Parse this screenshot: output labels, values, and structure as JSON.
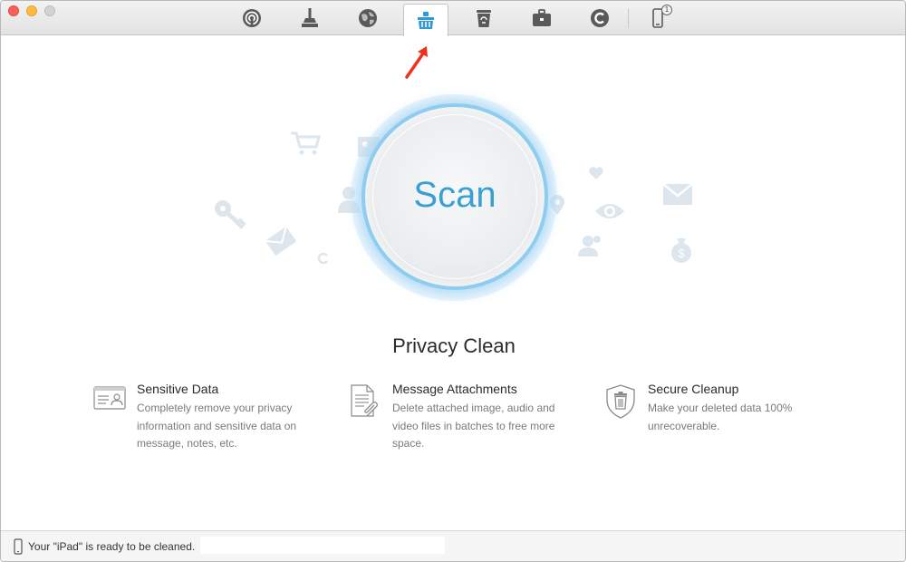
{
  "window": {
    "traffic_lights": [
      "close",
      "minimize",
      "zoom"
    ]
  },
  "toolbar": {
    "tools": [
      {
        "name": "airdrop-icon"
      },
      {
        "name": "broom-icon"
      },
      {
        "name": "globe-icon"
      },
      {
        "name": "privacy-clean-icon",
        "active": true
      },
      {
        "name": "trash-icon"
      },
      {
        "name": "toolbox-icon"
      },
      {
        "name": "circle-c-icon"
      },
      {
        "name": "phone-icon",
        "badge": "1"
      }
    ],
    "accent_color": "#3a9fd3"
  },
  "scan": {
    "label": "Scan",
    "ring_color": "#8fcdf0"
  },
  "section": {
    "title": "Privacy Clean"
  },
  "features": [
    {
      "title": "Sensitive Data",
      "description": "Completely remove your privacy information and sensitive data on message, notes, etc.",
      "icon": "id-card-icon"
    },
    {
      "title": "Message Attachments",
      "description": "Delete attached image, audio and video files in batches to free more space.",
      "icon": "document-attachment-icon"
    },
    {
      "title": "Secure Cleanup",
      "description": "Make your deleted data 100% unrecoverable.",
      "icon": "shield-trash-icon"
    }
  ],
  "status": {
    "text": "Your \"iPad\" is ready to be cleaned."
  },
  "annotation": {
    "arrow_color": "#f0301c"
  }
}
